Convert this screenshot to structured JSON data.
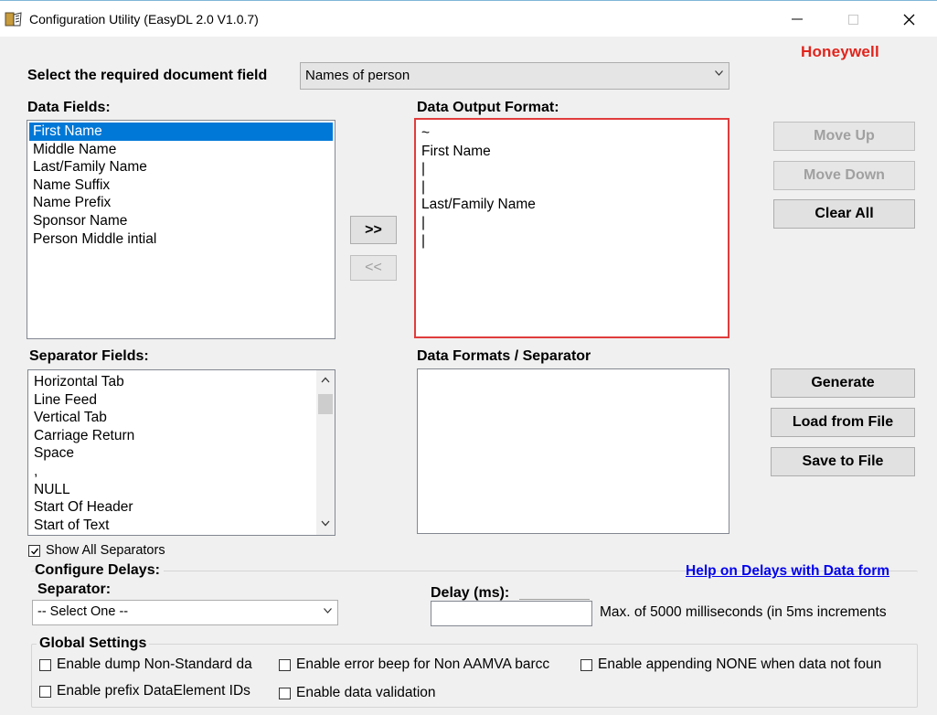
{
  "window": {
    "title": "Configuration Utility (EasyDL 2.0 V1.0.7)",
    "brand": "Honeywell"
  },
  "doc_field": {
    "label": "Select the required document field",
    "selected": "Names of person"
  },
  "data_fields": {
    "label": "Data Fields:",
    "items": [
      "First Name",
      "Middle Name",
      "Last/Family Name",
      "Name Suffix",
      "Name Prefix",
      "Sponsor Name",
      "Person Middle intial"
    ],
    "selected_index": 0
  },
  "transfer": {
    "add_label": ">>",
    "remove_label": "<<"
  },
  "output_format": {
    "label": "Data Output Format:",
    "lines": [
      "~",
      "First Name",
      "|",
      "|",
      "Last/Family Name",
      "|",
      "|"
    ]
  },
  "buttons": {
    "move_up": "Move Up",
    "move_down": "Move Down",
    "clear_all": "Clear All",
    "generate": "Generate",
    "load": "Load from File",
    "save": "Save to File"
  },
  "separator_fields": {
    "label": "Separator Fields:",
    "items": [
      "Horizontal Tab",
      "Line Feed",
      "Vertical Tab",
      "Carriage Return",
      "Space",
      ",",
      "NULL",
      "Start Of Header",
      "Start of Text"
    ]
  },
  "formats_separator": {
    "label": "Data Formats / Separator"
  },
  "show_all": {
    "label": "Show All Separators",
    "checked": true
  },
  "delays": {
    "group_label": "Configure Delays:",
    "help_link": "Help on Delays with Data form",
    "separator_label": "Separator:",
    "separator_selected": "-- Select One --",
    "delay_label": "Delay (ms):",
    "delay_value": "",
    "max_note": "Max. of 5000 milliseconds (in 5ms increments"
  },
  "global": {
    "label": "Global Settings",
    "options": [
      "Enable dump Non-Standard da",
      "Enable error beep for Non AAMVA barcc",
      "Enable appending NONE when data not foun",
      "Enable prefix DataElement IDs",
      "Enable data validation"
    ]
  },
  "colors": {
    "accent": "#0078d7",
    "brand": "#e0241c",
    "highlight_border": "#e03c3c"
  }
}
